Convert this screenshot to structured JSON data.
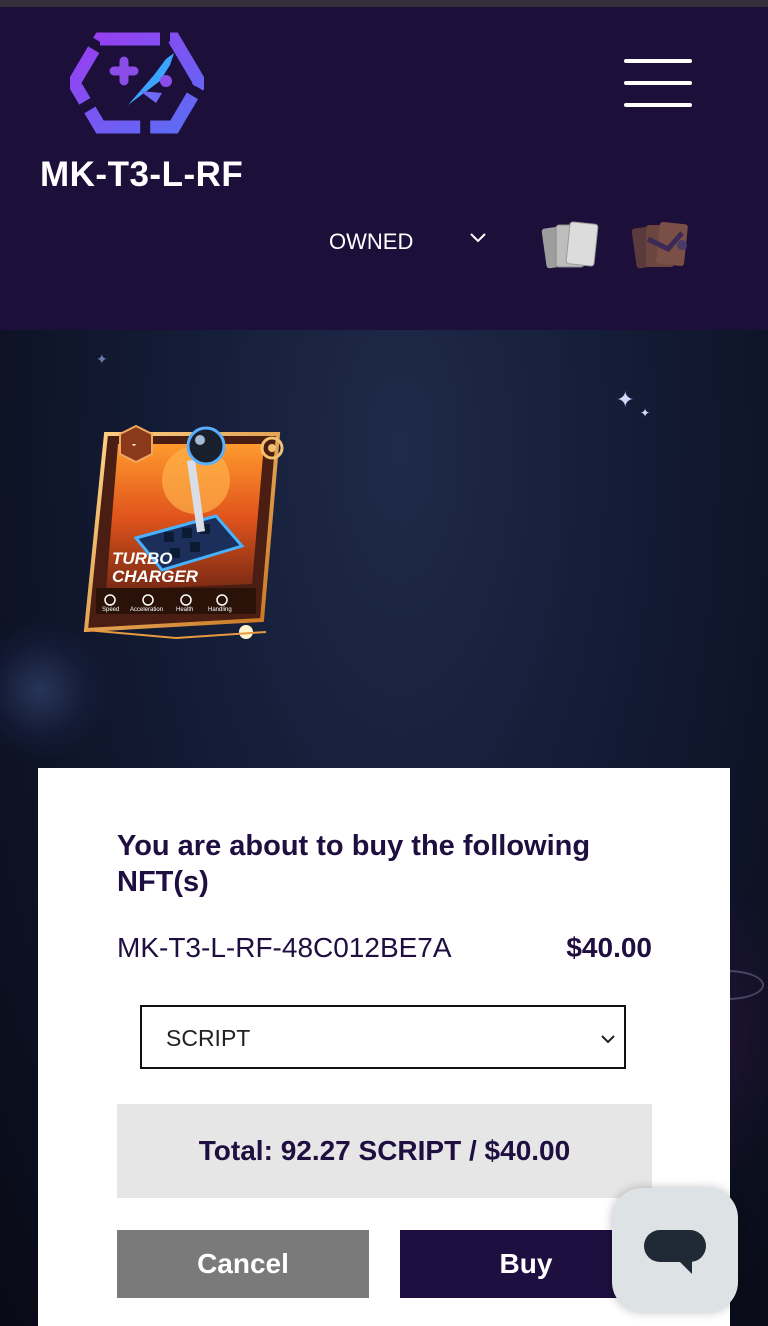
{
  "header": {
    "title": "MK-T3-L-RF",
    "logo_icon": "rocket-gamepad-logo",
    "menu_icon": "hamburger-menu-icon",
    "filter": {
      "selected": "OWNED",
      "icon": "chevron-down-icon"
    },
    "view_toggles": [
      {
        "name": "cards-view-icon"
      },
      {
        "name": "packs-view-icon"
      }
    ]
  },
  "nft_card": {
    "title_line1": "TURBO",
    "title_line2": "CHARGER",
    "stats": [
      "Speed",
      "Acceleration",
      "Health",
      "Handling"
    ],
    "badge": "-"
  },
  "modal": {
    "heading": "You are about to buy the following NFT(s)",
    "item_id": "MK-T3-L-RF-48C012BE7A",
    "item_price": "$40.00",
    "currency": {
      "selected": "SCRIPT"
    },
    "total": "Total: 92.27 SCRIPT / $40.00",
    "cancel_label": "Cancel",
    "buy_label": "Buy"
  },
  "colors": {
    "header_bg": "#1c0f3a",
    "brand_dark": "#1e0f40",
    "cancel_gray": "#7a7a7a",
    "logo_purple": "#8a4de8",
    "logo_blue": "#3aa4ff"
  }
}
